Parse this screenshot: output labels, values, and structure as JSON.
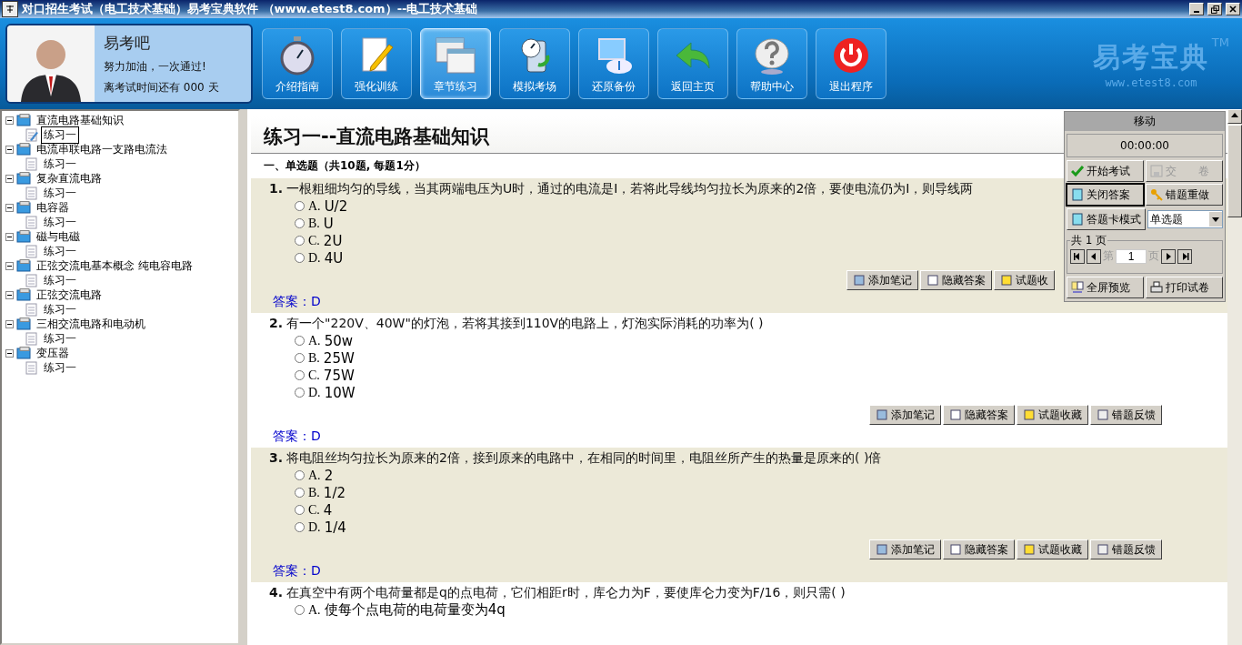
{
  "window": {
    "title": "对口招生考试（电工技术基础）易考宝典软件 （www.etest8.com）--电工技术基础"
  },
  "profile": {
    "name": "易考吧",
    "slogan": "努力加油，一次通过!",
    "countdown": "离考试时间还有 000 天"
  },
  "toolbar": [
    {
      "label": "介绍指南",
      "selected": false
    },
    {
      "label": "强化训练",
      "selected": false
    },
    {
      "label": "章节练习",
      "selected": true
    },
    {
      "label": "模拟考场",
      "selected": false
    },
    {
      "label": "还原备份",
      "selected": false
    },
    {
      "label": "返回主页",
      "selected": false
    },
    {
      "label": "帮助中心",
      "selected": false
    },
    {
      "label": "退出程序",
      "selected": false
    }
  ],
  "logo": {
    "name": "易考宝典",
    "tm": "TM",
    "url": "www.etest8.com"
  },
  "tree": [
    {
      "label": "直流电路基础知识",
      "expanded": true,
      "children": [
        {
          "label": "练习一",
          "selected": true
        }
      ]
    },
    {
      "label": "电流串联电路一支路电流法",
      "expanded": true,
      "children": [
        {
          "label": "练习一",
          "selected": false
        }
      ]
    },
    {
      "label": "复杂直流电路",
      "expanded": true,
      "children": [
        {
          "label": "练习一",
          "selected": false
        }
      ]
    },
    {
      "label": "电容器",
      "expanded": true,
      "children": [
        {
          "label": "练习一",
          "selected": false
        }
      ]
    },
    {
      "label": "磁与电磁",
      "expanded": true,
      "children": [
        {
          "label": "练习一",
          "selected": false
        }
      ]
    },
    {
      "label": "正弦交流电基本概念 纯电容电路",
      "expanded": true,
      "children": [
        {
          "label": "练习一",
          "selected": false
        }
      ]
    },
    {
      "label": "正弦交流电路",
      "expanded": true,
      "children": [
        {
          "label": "练习一",
          "selected": false
        }
      ]
    },
    {
      "label": "三相交流电路和电动机",
      "expanded": true,
      "children": [
        {
          "label": "练习一",
          "selected": false
        }
      ]
    },
    {
      "label": "变压器",
      "expanded": true,
      "children": [
        {
          "label": "练习一",
          "selected": false
        }
      ]
    }
  ],
  "exercise": {
    "title": "练习一--直流电路基础知识",
    "section": "一、单选题（共10题, 每题1分）",
    "questions": [
      {
        "number": "1.",
        "text": "一根粗细均匀的导线，当其两端电压为U时，通过的电流是I，若将此导线均匀拉长为原来的2倍，要使电流仍为I，则导线两",
        "options": [
          {
            "letter": "A.",
            "text": "U/2",
            "selected": false
          },
          {
            "letter": "B.",
            "text": "U",
            "selected": false
          },
          {
            "letter": "C.",
            "text": "2U",
            "selected": false
          },
          {
            "letter": "D.",
            "text": "4U",
            "selected": false
          }
        ],
        "actions": [
          "添加笔记",
          "隐藏答案",
          "试题收"
        ],
        "answer": "答案：D",
        "highlighted": true
      },
      {
        "number": "2.",
        "text": "有一个\"220V、40W\"的灯泡，若将其接到110V的电路上，灯泡实际消耗的功率为( )",
        "options": [
          {
            "letter": "A.",
            "text": "50w",
            "selected": false
          },
          {
            "letter": "B.",
            "text": "25W",
            "selected": false
          },
          {
            "letter": "C.",
            "text": "75W",
            "selected": false
          },
          {
            "letter": "D.",
            "text": "10W",
            "selected": false
          }
        ],
        "actions": [
          "添加笔记",
          "隐藏答案",
          "试题收藏",
          "错题反馈"
        ],
        "answer": "答案：D",
        "highlighted": false
      },
      {
        "number": "3.",
        "text": "将电阻丝均匀拉长为原来的2倍，接到原来的电路中，在相同的时间里，电阻丝所产生的热量是原来的( )倍",
        "options": [
          {
            "letter": "A.",
            "text": "2",
            "selected": false
          },
          {
            "letter": "B.",
            "text": "1/2",
            "selected": false
          },
          {
            "letter": "C.",
            "text": "4",
            "selected": false
          },
          {
            "letter": "D.",
            "text": "1/4",
            "selected": false
          }
        ],
        "actions": [
          "添加笔记",
          "隐藏答案",
          "试题收藏",
          "错题反馈"
        ],
        "answer": "答案：D",
        "highlighted": true
      },
      {
        "number": "4.",
        "text": "在真空中有两个电荷量都是q的点电荷，它们相距r时，库仑力为F，要使库仑力变为F/16，则只需( )",
        "options": [
          {
            "letter": "A.",
            "text": "使每个点电荷的电荷量变为4q",
            "selected": false
          }
        ],
        "highlighted": false
      }
    ]
  },
  "panel": {
    "title": "移动",
    "timer": "00:00:00",
    "buttons": [
      {
        "label": "开始考试",
        "disabled": false,
        "pressed": false
      },
      {
        "label": "交　　卷",
        "disabled": true,
        "pressed": false
      },
      {
        "label": "关闭答案",
        "disabled": false,
        "pressed": true
      },
      {
        "label": "错题重做",
        "disabled": false,
        "pressed": false
      }
    ],
    "mode_button": "答题卡模式",
    "type_select": "单选题",
    "pages": {
      "legend": "共 1 页",
      "before": "第",
      "page": "1",
      "after": "页"
    },
    "bottom_buttons": [
      "全屏预览",
      "打印试卷"
    ]
  }
}
